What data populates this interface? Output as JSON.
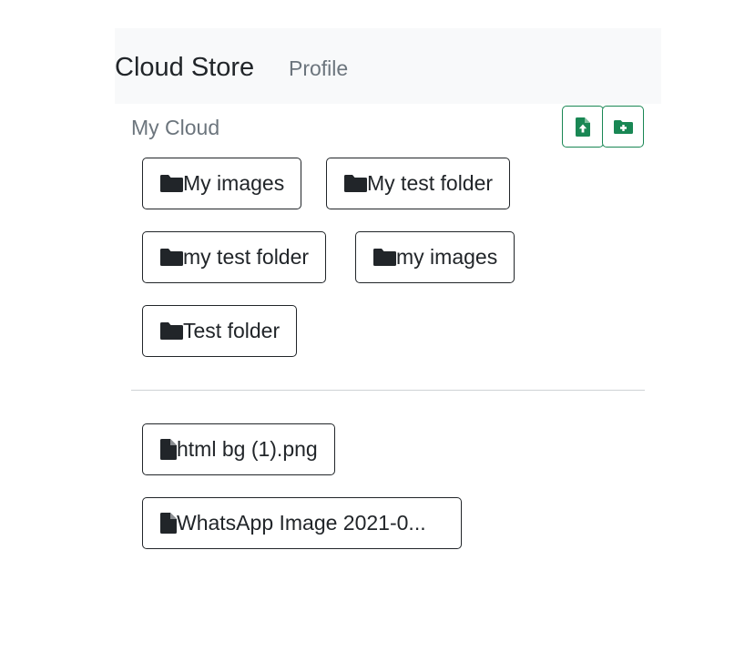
{
  "navbar": {
    "brand": "Cloud Store",
    "links": [
      {
        "label": "Profile"
      }
    ]
  },
  "main": {
    "title": "My Cloud",
    "actions": [
      {
        "icon": "file-upload-icon",
        "color": "#198754"
      },
      {
        "icon": "folder-plus-icon",
        "color": "#198754"
      }
    ],
    "folders": [
      {
        "name": "My images",
        "icon": "folder-icon"
      },
      {
        "name": "My test folder",
        "icon": "folder-icon"
      },
      {
        "name": "my test folder",
        "icon": "folder-icon"
      },
      {
        "name": "my images",
        "icon": "folder-icon"
      },
      {
        "name": "Test folder",
        "icon": "folder-icon"
      }
    ],
    "files": [
      {
        "name": "html bg (1).png",
        "icon": "file-icon"
      },
      {
        "name": "WhatsApp Image 2021-0...",
        "icon": "file-icon"
      }
    ]
  },
  "colors": {
    "accent": "#198754",
    "navbar_bg": "#f8f9fa",
    "muted_text": "#6c757d",
    "dark": "#212529"
  }
}
